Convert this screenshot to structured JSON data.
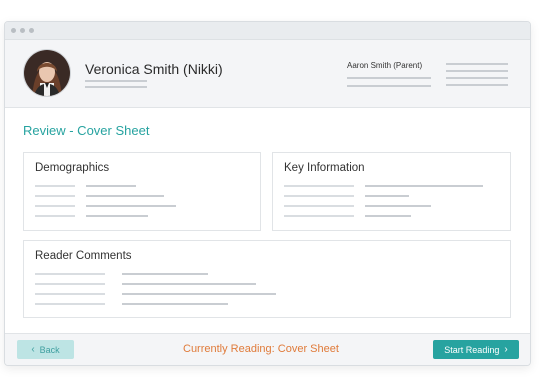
{
  "header": {
    "user_name": "Veronica Smith (Nikki)",
    "parent_label": "Aaron Smith (Parent)"
  },
  "main": {
    "section_title": "Review - Cover Sheet",
    "cards": {
      "demographics": "Demographics",
      "key_information": "Key Information",
      "reader_comments": "Reader Comments"
    }
  },
  "footer": {
    "back_label": "Back",
    "current_reading": "Currently Reading: Cover Sheet",
    "start_label": "Start Reading"
  },
  "colors": {
    "accent": "#27a3a0",
    "status": "#e07b3a"
  },
  "icons": [
    "avatar-photo",
    "chevron-left-icon",
    "chevron-right-icon"
  ]
}
